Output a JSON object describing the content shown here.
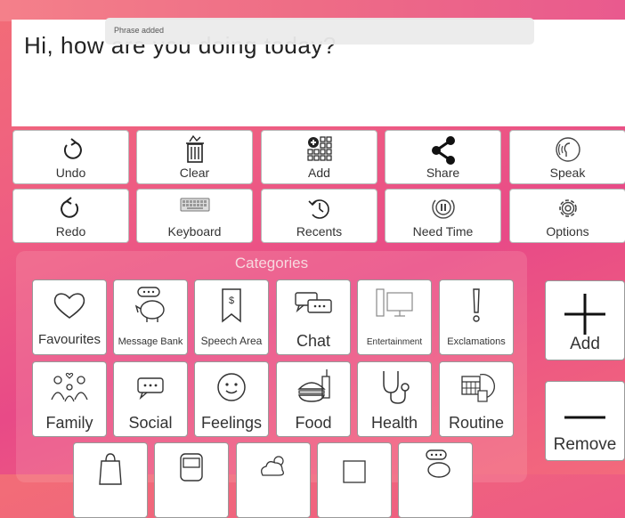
{
  "message": {
    "text": "Hi, how are you doing today?"
  },
  "toast": {
    "text": "Phrase added"
  },
  "toolbar": [
    {
      "label": "Undo",
      "icon": "undo-icon"
    },
    {
      "label": "Clear",
      "icon": "trash-icon"
    },
    {
      "label": "Add",
      "icon": "add-grid-icon"
    },
    {
      "label": "Share",
      "icon": "share-icon"
    },
    {
      "label": "Speak",
      "icon": "speak-icon"
    },
    {
      "label": "Redo",
      "icon": "redo-icon"
    },
    {
      "label": "Keyboard",
      "icon": "keyboard-icon"
    },
    {
      "label": "Recents",
      "icon": "history-icon"
    },
    {
      "label": "Need Time",
      "icon": "pause-icon"
    },
    {
      "label": "Options",
      "icon": "gear-icon"
    }
  ],
  "categories": {
    "title": "Categories",
    "items": [
      {
        "label": "Favourites",
        "icon": "heart-icon"
      },
      {
        "label": "Message Bank",
        "icon": "piggy-bank-icon"
      },
      {
        "label": "Speech Area",
        "icon": "bookmark-icon"
      },
      {
        "label": "Chat",
        "icon": "chat-icon"
      },
      {
        "label": "Entertainment",
        "icon": "computer-icon"
      },
      {
        "label": "Exclamations",
        "icon": "exclamation-icon"
      },
      {
        "label": "Family",
        "icon": "family-icon"
      },
      {
        "label": "Social",
        "icon": "speech-bubble-icon"
      },
      {
        "label": "Feelings",
        "icon": "smiley-icon"
      },
      {
        "label": "Food",
        "icon": "food-icon"
      },
      {
        "label": "Health",
        "icon": "stethoscope-icon"
      },
      {
        "label": "Routine",
        "icon": "calendar-icon"
      }
    ]
  },
  "side": {
    "add_label": "Add",
    "remove_label": "Remove"
  }
}
